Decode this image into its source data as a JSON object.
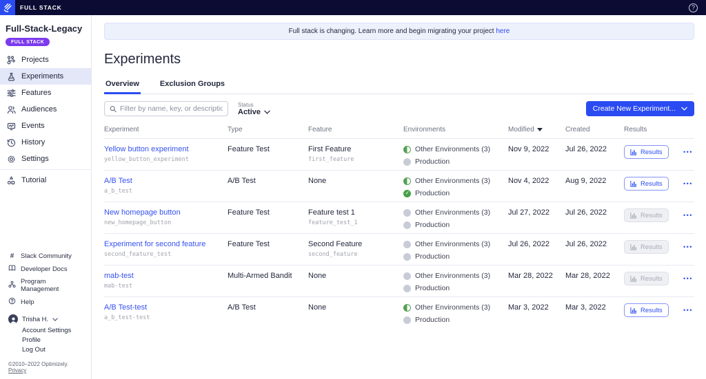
{
  "topbar": {
    "brand": "FULL STACK",
    "help_icon": "?"
  },
  "sidebar": {
    "project_name": "Full-Stack-Legacy",
    "project_badge": "FULL STACK",
    "nav": [
      {
        "icon": "projects-icon",
        "label": "Projects",
        "active": false
      },
      {
        "icon": "experiments-icon",
        "label": "Experiments",
        "active": true
      },
      {
        "icon": "features-icon",
        "label": "Features",
        "active": false
      },
      {
        "icon": "audiences-icon",
        "label": "Audiences",
        "active": false
      },
      {
        "icon": "events-icon",
        "label": "Events",
        "active": false
      },
      {
        "icon": "history-icon",
        "label": "History",
        "active": false
      },
      {
        "icon": "settings-icon",
        "label": "Settings",
        "active": false
      },
      {
        "icon": "tutorial-icon",
        "label": "Tutorial",
        "active": false
      }
    ],
    "footer_links": [
      {
        "icon": "hash-icon",
        "label": "Slack Community"
      },
      {
        "icon": "book-icon",
        "label": "Developer Docs"
      },
      {
        "icon": "org-icon",
        "label": "Program Management"
      },
      {
        "icon": "help-icon",
        "label": "Help"
      }
    ],
    "user": {
      "name": "Trisha H.",
      "menu": [
        "Account Settings",
        "Profile",
        "Log Out"
      ]
    },
    "copyright": "©2010–2022 Optimizely.",
    "privacy_link": "Privacy"
  },
  "banner": {
    "text": "Full stack is changing. Learn more and begin migrating your project",
    "link": "here"
  },
  "page": {
    "title": "Experiments",
    "tabs": [
      {
        "label": "Overview",
        "active": true
      },
      {
        "label": "Exclusion Groups",
        "active": false
      }
    ]
  },
  "toolbar": {
    "filter_placeholder": "Filter by name, key, or description",
    "status_label": "Status",
    "status_value": "Active",
    "create_button": "Create New Experiment..."
  },
  "table": {
    "headers": [
      "Experiment",
      "Type",
      "Feature",
      "Environments",
      "Modified",
      "Created",
      "Results"
    ],
    "sorted_by": "Modified",
    "results_label": "Results",
    "rows": [
      {
        "name": "Yellow button experiment",
        "key": "yellow_button_experiment",
        "type": "Feature Test",
        "feature": "First Feature",
        "feature_key": "first_feature",
        "environments": [
          {
            "label": "Other Environments (3)",
            "state": "partial"
          },
          {
            "label": "Production",
            "state": "off"
          }
        ],
        "modified": "Nov 9, 2022",
        "created": "Jul 26, 2022",
        "results_enabled": true
      },
      {
        "name": "A/B Test",
        "key": "a_b_test",
        "type": "A/B Test",
        "feature": "None",
        "feature_key": "",
        "environments": [
          {
            "label": "Other Environments (3)",
            "state": "partial"
          },
          {
            "label": "Production",
            "state": "running"
          }
        ],
        "modified": "Nov 4, 2022",
        "created": "Aug 9, 2022",
        "results_enabled": true
      },
      {
        "name": "New homepage button",
        "key": "new_homepage_button",
        "type": "Feature Test",
        "feature": "Feature test 1",
        "feature_key": "feature_test_1",
        "environments": [
          {
            "label": "Other Environments (3)",
            "state": "off"
          },
          {
            "label": "Production",
            "state": "off"
          }
        ],
        "modified": "Jul 27, 2022",
        "created": "Jul 26, 2022",
        "results_enabled": false
      },
      {
        "name": "Experiment for second feature",
        "key": "second_feature_test",
        "type": "Feature Test",
        "feature": "Second Feature",
        "feature_key": "second_feature",
        "environments": [
          {
            "label": "Other Environments (3)",
            "state": "off"
          },
          {
            "label": "Production",
            "state": "off"
          }
        ],
        "modified": "Jul 26, 2022",
        "created": "Jul 26, 2022",
        "results_enabled": false
      },
      {
        "name": "mab-test",
        "key": "mab-test",
        "type": "Multi-Armed Bandit",
        "feature": "None",
        "feature_key": "",
        "environments": [
          {
            "label": "Other Environments (3)",
            "state": "off"
          },
          {
            "label": "Production",
            "state": "off"
          }
        ],
        "modified": "Mar 28, 2022",
        "created": "Mar 28, 2022",
        "results_enabled": false
      },
      {
        "name": "A/B Test-test",
        "key": "a_b_test-test",
        "type": "A/B Test",
        "feature": "None",
        "feature_key": "",
        "environments": [
          {
            "label": "Other Environments (3)",
            "state": "partial"
          },
          {
            "label": "Production",
            "state": "off"
          }
        ],
        "modified": "Mar 3, 2022",
        "created": "Mar 3, 2022",
        "results_enabled": true
      }
    ]
  },
  "colors": {
    "accent_blue": "#2a4bf2",
    "badge_purple": "#7c3aed",
    "running_green": "#44a047",
    "topbar_navy": "#0b0b33"
  }
}
